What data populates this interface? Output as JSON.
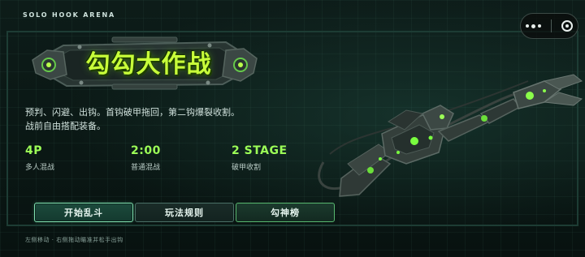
{
  "header": {
    "app_title": "SOLO HOOK ARENA"
  },
  "logo": {
    "text": "勾勾大作战"
  },
  "description": {
    "line1": "预判、闪避、出钩。首钩破甲拖回，第二钩爆裂收割。",
    "line2": "战前自由搭配装备。"
  },
  "stats": [
    {
      "value": "4P",
      "label": "多人混战"
    },
    {
      "value": "2:00",
      "label": "普通混战"
    },
    {
      "value": "2 STAGE",
      "label": "破甲收割"
    }
  ],
  "buttons": {
    "start": "开始乱斗",
    "rules": "玩法规则",
    "rank": "勾神榜"
  },
  "hint": "左侧移动 · 右侧拖动瞄准并松手出钩",
  "colors": {
    "accent": "#9cff57",
    "logo": "#c8ff3a",
    "background": "#0a1513"
  }
}
